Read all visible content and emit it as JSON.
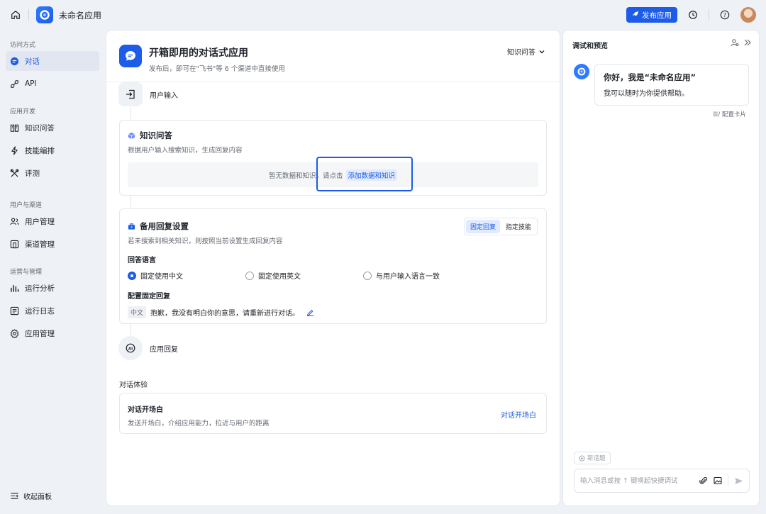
{
  "topbar": {
    "app_name": "未命名应用",
    "publish_label": "发布应用"
  },
  "sidebar": {
    "groups": [
      {
        "title": "访问方式",
        "items": [
          {
            "label": "对话",
            "icon": "chat-icon",
            "active": true
          },
          {
            "label": "API",
            "icon": "api-icon"
          }
        ]
      },
      {
        "title": "应用开发",
        "items": [
          {
            "label": "知识问答",
            "icon": "book-icon"
          },
          {
            "label": "技能编排",
            "icon": "flash-icon"
          },
          {
            "label": "评测",
            "icon": "tools-icon"
          }
        ]
      },
      {
        "title": "用户与渠道",
        "items": [
          {
            "label": "用户管理",
            "icon": "users-icon"
          },
          {
            "label": "渠道管理",
            "icon": "channel-icon"
          }
        ]
      },
      {
        "title": "运营与管理",
        "items": [
          {
            "label": "运行分析",
            "icon": "bar-chart-icon"
          },
          {
            "label": "运行日志",
            "icon": "log-icon"
          },
          {
            "label": "应用管理",
            "icon": "gear-icon"
          }
        ]
      }
    ],
    "collapse_label": "收起面板"
  },
  "main": {
    "title": "开箱即用的对话式应用",
    "subtitle": "发布后，即可在\"飞书\"等 6 个渠道中直接使用",
    "mode": "知识问答",
    "user_input_label": "用户输入",
    "knowledge": {
      "title": "知识问答",
      "desc": "根据用户输入搜索知识，生成回复内容",
      "empty_text": "暂无数据和知识，请点击",
      "add_link": "添加数据和知识"
    },
    "fallback": {
      "title": "备用回复设置",
      "desc": "若未搜索到相关知识，则按照当前设置生成回复内容",
      "seg_options": [
        "固定回复",
        "指定技能"
      ],
      "language_heading": "回答语言",
      "radios": [
        "固定使用中文",
        "固定使用英文",
        "与用户输入语言一致"
      ],
      "fixed_heading": "配置固定回复",
      "lang_tag": "中文",
      "fixed_reply": "抱歉，我没有明白你的意思，请重新进行对话。"
    },
    "app_reply_label": "应用回复",
    "experience_label": "对话体验",
    "opening": {
      "title": "对话开场白",
      "desc": "发送开场白，介绍应用能力，拉近与用户的距离",
      "link": "对话开场白"
    }
  },
  "preview": {
    "title": "调试和预览",
    "greeting_title": "你好，我是“未命名应用”",
    "greeting_text": "我可以随时为你提供帮助。",
    "config_card": "配置卡片",
    "new_topic": "新话题",
    "input_placeholder": "输入消息或按 ↑ 键唤起快捷调试"
  },
  "colors": {
    "accent": "#1d5ce8",
    "background": "#eef1f6"
  }
}
